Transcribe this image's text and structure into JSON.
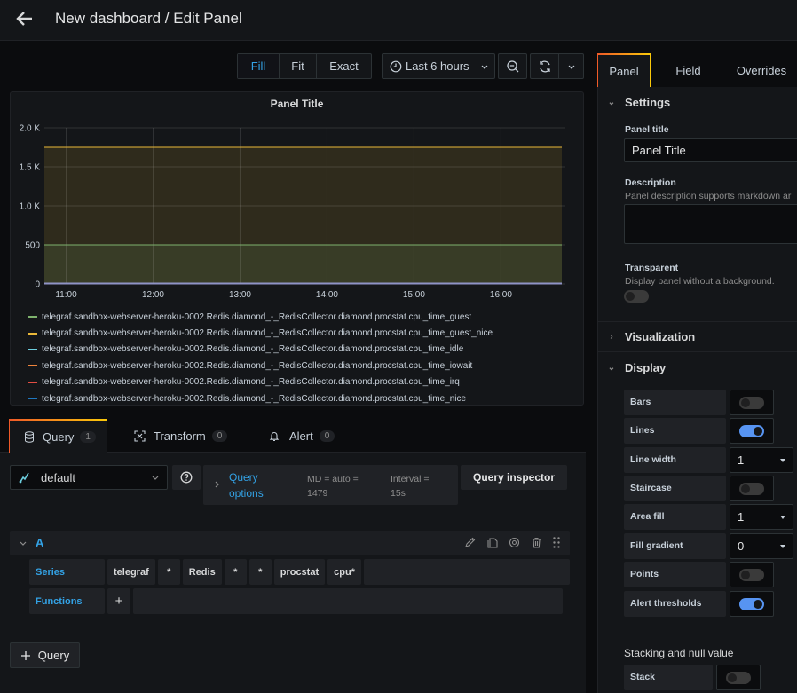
{
  "header": {
    "title": "New dashboard / Edit Panel",
    "back_icon": "arrow-left-icon"
  },
  "toolbar": {
    "view_modes": [
      {
        "label": "Fill",
        "active": true
      },
      {
        "label": "Fit",
        "active": false
      },
      {
        "label": "Exact",
        "active": false
      }
    ],
    "time_range": "Last 6 hours",
    "zoom_icon": "zoom-out-icon",
    "refresh_icon": "refresh-icon"
  },
  "panel": {
    "title": "Panel Title"
  },
  "chart_data": {
    "type": "area",
    "title": "Panel Title",
    "xlabel": "",
    "ylabel": "",
    "x_ticks": [
      "11:00",
      "12:00",
      "13:00",
      "14:00",
      "15:00",
      "16:00"
    ],
    "y_ticks": [
      "0",
      "500",
      "1.0 K",
      "1.5 K",
      "2.0 K"
    ],
    "ylim": [
      0,
      2000
    ],
    "x_range": [
      "10:45",
      "16:42"
    ],
    "grid": true,
    "legend_position": "bottom",
    "series": [
      {
        "name": "telegraf.sandbox-webserver-heroku-0002.Redis.diamond_-_RedisCollector.diamond.procstat.cpu_time_guest",
        "color": "#7eb26d",
        "value": 500
      },
      {
        "name": "telegraf.sandbox-webserver-heroku-0002.Redis.diamond_-_RedisCollector.diamond.procstat.cpu_time_guest_nice",
        "color": "#eab839",
        "value": 1750
      },
      {
        "name": "telegraf.sandbox-webserver-heroku-0002.Redis.diamond_-_RedisCollector.diamond.procstat.cpu_time_idle",
        "color": "#6ed0e0",
        "value": 0
      },
      {
        "name": "telegraf.sandbox-webserver-heroku-0002.Redis.diamond_-_RedisCollector.diamond.procstat.cpu_time_iowait",
        "color": "#ef843c",
        "value": 0
      },
      {
        "name": "telegraf.sandbox-webserver-heroku-0002.Redis.diamond_-_RedisCollector.diamond.procstat.cpu_time_irq",
        "color": "#e24d42",
        "value": 0
      },
      {
        "name": "telegraf.sandbox-webserver-heroku-0002.Redis.diamond_-_RedisCollector.diamond.procstat.cpu_time_nice",
        "color": "#1f78c1",
        "value": 0
      }
    ]
  },
  "query_tabs": [
    {
      "label": "Query",
      "count": "1",
      "icon": "database-icon",
      "active": true
    },
    {
      "label": "Transform",
      "count": "0",
      "icon": "transform-icon",
      "active": false
    },
    {
      "label": "Alert",
      "count": "0",
      "icon": "bell-icon",
      "active": false
    }
  ],
  "query": {
    "datasource": "default",
    "options_label_1": "Query",
    "options_label_2": "options",
    "md_1": "MD = auto =",
    "md_2": "1479",
    "interval_1": "Interval =",
    "interval_2": "15s",
    "inspector": "Query inspector",
    "ref_id": "A",
    "series_label": "Series",
    "series_segments": [
      "telegraf",
      "*",
      "Redis",
      "*",
      "*",
      "procstat",
      "cpu*"
    ],
    "functions_label": "Functions",
    "add_function": "+",
    "add_query": "Query"
  },
  "sidebar": {
    "tabs": [
      {
        "label": "Panel",
        "active": true
      },
      {
        "label": "Field",
        "active": false
      },
      {
        "label": "Overrides",
        "active": false
      }
    ],
    "settings": {
      "heading": "Settings",
      "panel_title_label": "Panel title",
      "panel_title_value": "Panel Title",
      "description_label": "Description",
      "description_hint": "Panel description supports markdown ar",
      "transparent_label": "Transparent",
      "transparent_hint": "Display panel without a background.",
      "transparent_on": false
    },
    "visualization_heading": "Visualization",
    "display": {
      "heading": "Display",
      "options": [
        {
          "label": "Bars",
          "type": "toggle",
          "on": false
        },
        {
          "label": "Lines",
          "type": "toggle",
          "on": true
        },
        {
          "label": "Line width",
          "type": "select",
          "value": "1"
        },
        {
          "label": "Staircase",
          "type": "toggle",
          "on": false
        },
        {
          "label": "Area fill",
          "type": "select",
          "value": "1"
        },
        {
          "label": "Fill gradient",
          "type": "select",
          "value": "0"
        },
        {
          "label": "Points",
          "type": "toggle",
          "on": false
        },
        {
          "label": "Alert thresholds",
          "type": "toggle",
          "on": true
        }
      ]
    },
    "stacking": {
      "heading": "Stacking and null value",
      "stack_label": "Stack",
      "stack_on": false
    }
  }
}
